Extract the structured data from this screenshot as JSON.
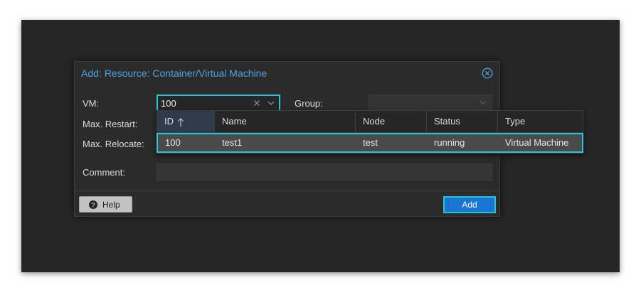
{
  "dialog": {
    "title": "Add: Resource: Container/Virtual Machine",
    "close_icon": "close-circle-icon"
  },
  "form": {
    "vm_label": "VM:",
    "vm_value": "100",
    "group_label": "Group:",
    "group_value": "",
    "max_restart_label": "Max. Restart:",
    "max_relocate_label": "Max. Relocate:",
    "comment_label": "Comment:",
    "comment_value": ""
  },
  "footer": {
    "help_label": "Help",
    "add_label": "Add"
  },
  "picker": {
    "columns": [
      "ID",
      "Name",
      "Node",
      "Status",
      "Type"
    ],
    "sorted_column": "ID",
    "sort_direction": "ascending",
    "rows": [
      {
        "id": "100",
        "name": "test1",
        "node": "test",
        "status": "running",
        "type": "Virtual Machine"
      }
    ]
  },
  "colors": {
    "accent": "#26c6da",
    "title": "#4aa3df",
    "primary_button": "#1976d2",
    "background": "#262626"
  }
}
